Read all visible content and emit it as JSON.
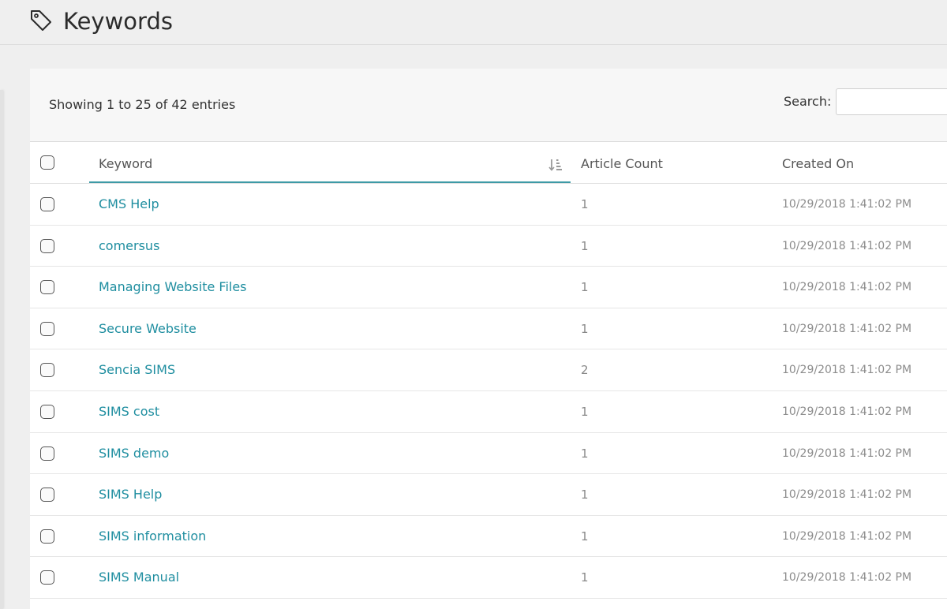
{
  "header": {
    "icon": "tag-icon",
    "title": "Keywords"
  },
  "table_info": {
    "text": "Showing 1 to 25 of 42 entries"
  },
  "search": {
    "label": "Search:",
    "value": ""
  },
  "columns": {
    "keyword": "Keyword",
    "article_count": "Article Count",
    "created_on": "Created On",
    "sort_icon": "sort-descending-icon"
  },
  "rows": [
    {
      "keyword": "CMS Help",
      "article_count": "1",
      "created_on": "10/29/2018 1:41:02 PM"
    },
    {
      "keyword": "comersus",
      "article_count": "1",
      "created_on": "10/29/2018 1:41:02 PM"
    },
    {
      "keyword": "Managing Website Files",
      "article_count": "1",
      "created_on": "10/29/2018 1:41:02 PM"
    },
    {
      "keyword": "Secure Website",
      "article_count": "1",
      "created_on": "10/29/2018 1:41:02 PM"
    },
    {
      "keyword": "Sencia SIMS",
      "article_count": "2",
      "created_on": "10/29/2018 1:41:02 PM"
    },
    {
      "keyword": "SIMS cost",
      "article_count": "1",
      "created_on": "10/29/2018 1:41:02 PM"
    },
    {
      "keyword": "SIMS demo",
      "article_count": "1",
      "created_on": "10/29/2018 1:41:02 PM"
    },
    {
      "keyword": "SIMS Help",
      "article_count": "1",
      "created_on": "10/29/2018 1:41:02 PM"
    },
    {
      "keyword": "SIMS information",
      "article_count": "1",
      "created_on": "10/29/2018 1:41:02 PM"
    },
    {
      "keyword": "SIMS Manual",
      "article_count": "1",
      "created_on": "10/29/2018 1:41:02 PM"
    }
  ],
  "colors": {
    "link": "#1f8ea0",
    "sort_underline": "#3e9aa6"
  }
}
